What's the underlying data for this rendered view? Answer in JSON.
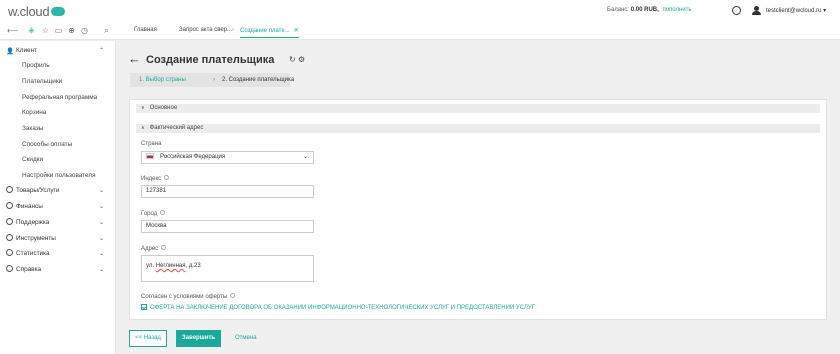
{
  "header": {
    "logo": "w.cloud",
    "balance_label": "Баланс:",
    "balance_value": "0.00 RUB,",
    "topup_link": "пополнить",
    "user_email": "testclient@wcloud.ru"
  },
  "toolbar": {
    "icons": [
      "back-icon",
      "network-icon",
      "star-icon",
      "folder-icon",
      "add-icon",
      "history-icon",
      "search-icon"
    ],
    "tabs": [
      {
        "label": "Главная"
      },
      {
        "label": "Запрос акта свер..."
      },
      {
        "label": "Создание плате...",
        "close": "✕"
      }
    ]
  },
  "sidebar": {
    "client": {
      "label": "Клиент"
    },
    "client_items": [
      {
        "label": "Профиль"
      },
      {
        "label": "Плательщики"
      },
      {
        "label": "Реферальная программа"
      },
      {
        "label": "Корзина"
      },
      {
        "label": "Заказы"
      },
      {
        "label": "Способы оплаты"
      },
      {
        "label": "Скидки"
      },
      {
        "label": "Настройки пользователя"
      }
    ],
    "sections": [
      {
        "label": "Товары/Услуги"
      },
      {
        "label": "Финансы"
      },
      {
        "label": "Поддержка"
      },
      {
        "label": "Инструменты"
      },
      {
        "label": "Статистика"
      },
      {
        "label": "Справка"
      }
    ]
  },
  "page": {
    "title": "Создание плательщика",
    "steps": [
      {
        "label": "1. Выбор страны"
      },
      {
        "label": "2. Создание плательщика"
      }
    ]
  },
  "form": {
    "section_basic": "Основное",
    "section_address": "Фактический адрес",
    "country_label": "Страна",
    "country_value": "Российская Федерация",
    "index_label": "Индекс",
    "index_value": "127381",
    "city_label": "Город",
    "city_value": "Москва",
    "address_label": "Адрес",
    "address_prefix": "ул. ",
    "address_street": "Неглинная",
    "address_suffix": ", д.23",
    "consent_label": "Согласен с условиями оферты",
    "consent_text": "ОФЕРТА НА ЗАКЛЮЧЕНИЕ ДОГОВОРА ОБ ОКАЗАНИИ ИНФОРМАЦИОННО-ТЕХНОЛОГИЧЕСКИХ УСЛУГ И ПРЕДОСТАВЛЕНИИ УСЛУГ"
  },
  "actions": {
    "back": "<< Назад",
    "finish": "Завершить",
    "cancel": "Отмена"
  },
  "colors": {
    "accent": "#1aa99a"
  }
}
